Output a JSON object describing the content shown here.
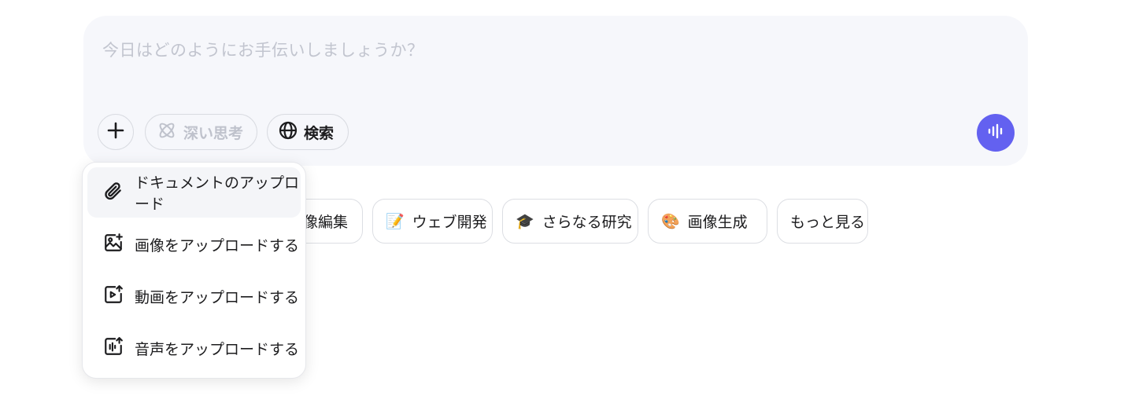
{
  "composer": {
    "placeholder": "今日はどのようにお手伝いしましょうか？",
    "deep_think_label": "深い思考",
    "search_label": "検索",
    "accent_color": "#6361f0"
  },
  "suggestions": [
    {
      "label": "像編集",
      "emoji": ""
    },
    {
      "label": "ウェブ開発",
      "emoji": "📝"
    },
    {
      "label": "さらなる研究",
      "emoji": "🎓"
    },
    {
      "label": "画像生成",
      "emoji": "🎨"
    },
    {
      "label": "もっと見る",
      "emoji": ""
    }
  ],
  "upload_menu": {
    "items": [
      {
        "label": "ドキュメントのアップロード",
        "icon": "paperclip-icon"
      },
      {
        "label": "画像をアップロードする",
        "icon": "image-upload-icon"
      },
      {
        "label": "動画をアップロードする",
        "icon": "video-upload-icon"
      },
      {
        "label": "音声をアップロードする",
        "icon": "audio-upload-icon"
      }
    ]
  }
}
